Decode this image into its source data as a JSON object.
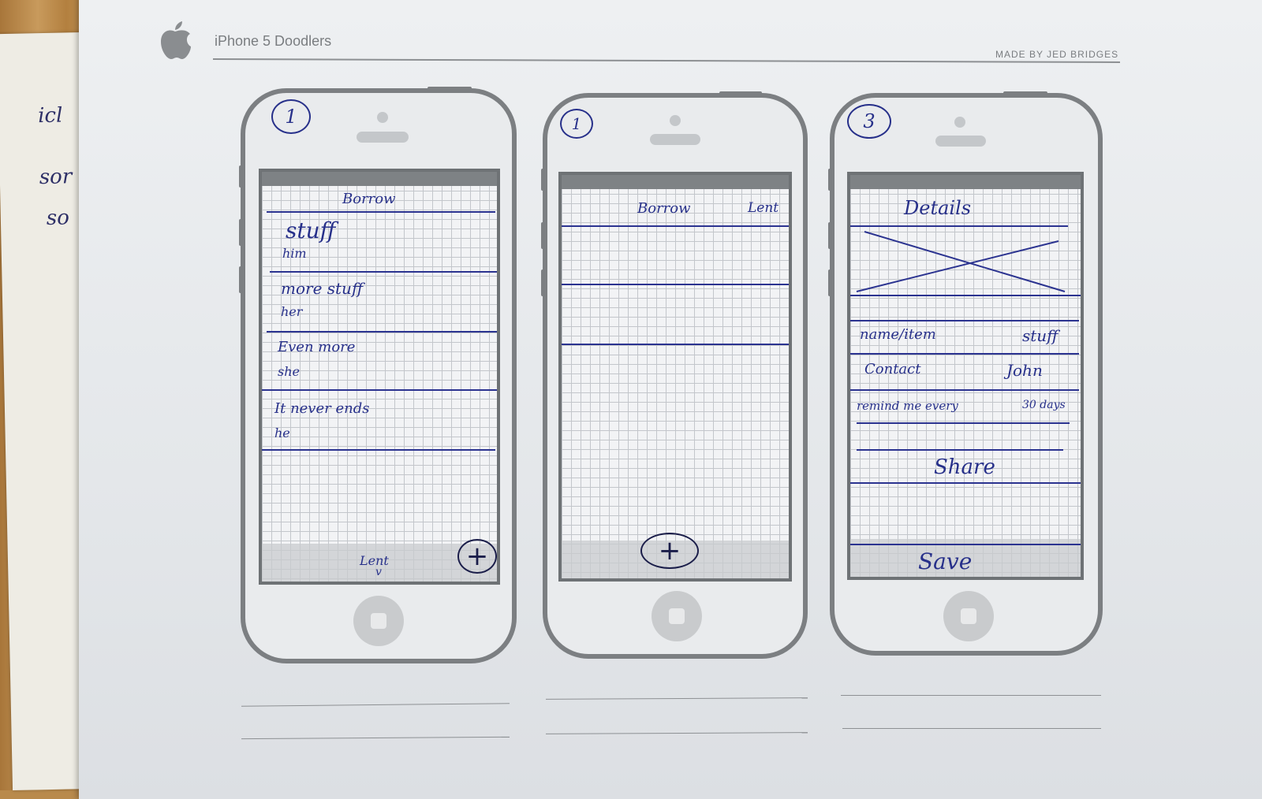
{
  "background_notes": [
    "icl",
    "sor",
    "so"
  ],
  "header": {
    "apple_logo_icon": "apple-logo-icon",
    "title": "iPhone 5 Doodlers",
    "credit": "MADE BY JED BRIDGES"
  },
  "screens": [
    {
      "number": "1",
      "title": "Borrow",
      "rows": [
        {
          "primary": "stuff",
          "secondary": "him"
        },
        {
          "primary": "more stuff",
          "secondary": "her"
        },
        {
          "primary": "Even more",
          "secondary": "she"
        },
        {
          "primary": "It never ends",
          "secondary": "he"
        }
      ],
      "bottom_tab": "Lent",
      "add_button": "+"
    },
    {
      "number": "1",
      "tab_left": "Borrow",
      "tab_right": "Lent",
      "add_button": "+"
    },
    {
      "number": "3",
      "title": "Details",
      "fields": [
        {
          "label": "name/item",
          "value": "stuff"
        },
        {
          "label": "Contact",
          "value": "John"
        },
        {
          "label": "remind me every",
          "value": "30 days"
        }
      ],
      "share_label": "Share",
      "save_label": "Save"
    }
  ],
  "colors": {
    "ink": "#27308a",
    "phone_outline": "#7c7f82",
    "paper": "#e4e7ea"
  }
}
